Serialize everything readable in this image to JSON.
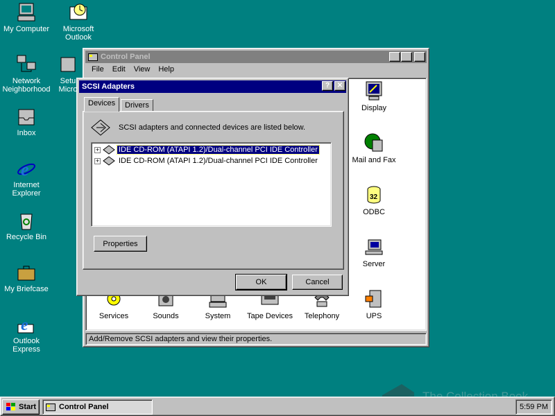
{
  "desktop": {
    "icons": [
      {
        "line1": "My Computer",
        "line2": ""
      },
      {
        "line1": "Microsoft",
        "line2": "Outlook"
      },
      {
        "line1": "Network",
        "line2": "Neighborhood"
      },
      {
        "line1": "Setu",
        "line2": "Micro"
      },
      {
        "line1": "Inbox",
        "line2": ""
      },
      {
        "line1": "Internet",
        "line2": "Explorer"
      },
      {
        "line1": "Recycle Bin",
        "line2": ""
      },
      {
        "line1": "My Briefcase",
        "line2": ""
      },
      {
        "line1": "Outlook",
        "line2": "Express"
      }
    ]
  },
  "control_panel": {
    "title": "Control Panel",
    "menu": [
      "File",
      "Edit",
      "View",
      "Help"
    ],
    "icons_right": [
      "Display",
      "Mail and Fax",
      "ODBC",
      "Server",
      "UPS"
    ],
    "icons_bottom": [
      "Services",
      "Sounds",
      "System",
      "Tape Devices",
      "Telephony"
    ],
    "status": "Add/Remove SCSI adapters and view their properties."
  },
  "scsi_dialog": {
    "title": "SCSI Adapters",
    "tabs": [
      "Devices",
      "Drivers"
    ],
    "description": "SCSI adapters and connected devices are listed below.",
    "devices": [
      "IDE CD-ROM (ATAPI 1.2)/Dual-channel PCI IDE Controller",
      "IDE CD-ROM (ATAPI 1.2)/Dual-channel PCI IDE Controller"
    ],
    "properties_label": "Properties",
    "ok_label": "OK",
    "cancel_label": "Cancel"
  },
  "taskbar": {
    "start_label": "Start",
    "task_label": "Control Panel",
    "clock": "5:59 PM"
  },
  "watermark": "The Collection Book"
}
